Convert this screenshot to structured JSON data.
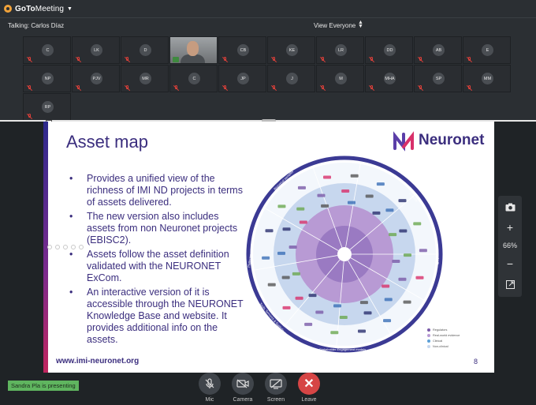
{
  "app": {
    "brand_bold": "GoTo",
    "brand_rest": "Meeting"
  },
  "talkbar": {
    "talking": "Talking: Carlos Díaz",
    "view": "View Everyone"
  },
  "participants": [
    {
      "initials": "C"
    },
    {
      "initials": "LK"
    },
    {
      "initials": "D"
    },
    {
      "initials": "",
      "video": true
    },
    {
      "initials": "CB"
    },
    {
      "initials": "KE"
    },
    {
      "initials": "LR"
    },
    {
      "initials": "DD"
    },
    {
      "initials": "AB"
    },
    {
      "initials": "E"
    },
    {
      "initials": "NP"
    },
    {
      "initials": "PJV"
    },
    {
      "initials": "MR"
    },
    {
      "initials": "C"
    },
    {
      "initials": "JP"
    },
    {
      "initials": "J"
    },
    {
      "initials": "M"
    },
    {
      "initials": "MHA"
    },
    {
      "initials": "SP"
    },
    {
      "initials": "MM"
    },
    {
      "initials": "RP"
    }
  ],
  "slide": {
    "title": "Asset map",
    "logo_text": "Neuronet",
    "bullets": [
      "Provides a unified view of the richness of IMI ND projects in terms of assets delivered.",
      "The new version also includes assets from non Neuronet projects (EBISC2).",
      "Assets follow the asset definition validated with the NEURONET ExCom.",
      "An interactive version of it is accessible through the NEURONET Knowledge Base and website. It provides additional info on the assets."
    ],
    "url": "www.imi-neuronet.org",
    "page": "8",
    "map_labels": {
      "datasets": "Datasets",
      "cohorts": "Cohorts",
      "biomarkers": "Biomarkers",
      "disease_models": "Disease models",
      "training": "Training",
      "stakeholder": "Stakeholder Engagement models",
      "tools": "Tools, Services & Guidelines",
      "platforms": "Platforms",
      "biological": "Biological samples"
    },
    "legend": [
      {
        "label": "Regulators",
        "color": "#7a5aa8"
      },
      {
        "label": "Real-world evidence",
        "color": "#b89ad4"
      },
      {
        "label": "Clinical",
        "color": "#5c9fd6"
      },
      {
        "label": "Non-clinical",
        "color": "#c7d7ee"
      }
    ]
  },
  "toolbar": {
    "zoom": "66%"
  },
  "status": {
    "presenting": "Sandra Pla is presenting"
  },
  "controls": {
    "mic": "Mic",
    "camera": "Camera",
    "screen": "Screen",
    "leave": "Leave"
  },
  "colors": {
    "accent_purple": "#3b2e7e",
    "leave_red": "#d64545",
    "presenting_green": "#5fb55f",
    "mic_off_red": "#e0403a"
  }
}
